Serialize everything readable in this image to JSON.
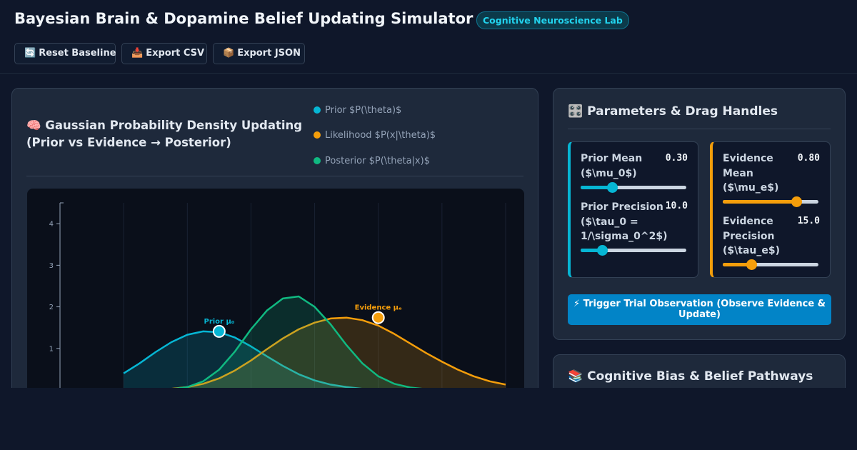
{
  "header": {
    "title": "Bayesian Brain & Dopamine Belief Updating Simulator",
    "badge": "Cognitive Neuroscience Lab"
  },
  "toolbar": {
    "reset": {
      "icon": "🔄",
      "icon_name": "refresh-icon",
      "label": "Reset Baseline"
    },
    "export_csv": {
      "icon": "📥",
      "icon_name": "inbox-tray-icon",
      "label": "Export CSV"
    },
    "export_json": {
      "icon": "📦",
      "icon_name": "package-icon",
      "label": "Export JSON"
    }
  },
  "chart_panel": {
    "icon": "🧠",
    "icon_name": "brain-icon",
    "title": "Gaussian Probability Density Updating (Prior vs Evidence → Posterior)",
    "legend": [
      {
        "label": "Prior $P(\\theta)$",
        "color": "#06b6d4"
      },
      {
        "label": "Likelihood $P(x|\\theta)$",
        "color": "#f59e0b"
      },
      {
        "label": "Posterior $P(\\theta|x)$",
        "color": "#10b981"
      }
    ]
  },
  "chart_data": {
    "type": "area",
    "x": [
      0.0,
      0.05,
      0.1,
      0.15,
      0.2,
      0.25,
      0.3,
      0.35,
      0.4,
      0.45,
      0.5,
      0.55,
      0.6,
      0.65,
      0.7,
      0.75,
      0.8,
      0.85,
      0.9,
      0.95,
      1.0,
      1.05,
      1.1,
      1.15,
      1.2
    ],
    "xlim": [
      -0.2,
      1.2
    ],
    "ylim": [
      0,
      4.5
    ],
    "yticks": [
      1,
      2,
      3,
      4
    ],
    "series": [
      {
        "name": "Prior $P(\\theta)$",
        "color": "#06b6d4",
        "values": [
          0.4,
          0.64,
          0.91,
          1.15,
          1.33,
          1.41,
          1.39,
          1.26,
          1.05,
          0.81,
          0.58,
          0.38,
          0.23,
          0.13,
          0.07,
          0.03,
          0.02,
          0.01,
          0.0,
          0.0,
          0.0,
          0.0,
          0.0,
          0.0,
          0.0
        ]
      },
      {
        "name": "Likelihood $P(x|\\theta)$",
        "color": "#f59e0b",
        "values": [
          0.0,
          0.0,
          0.01,
          0.03,
          0.07,
          0.15,
          0.28,
          0.47,
          0.71,
          0.98,
          1.24,
          1.46,
          1.62,
          1.72,
          1.74,
          1.68,
          1.55,
          1.35,
          1.12,
          0.89,
          0.68,
          0.49,
          0.33,
          0.21,
          0.13
        ]
      },
      {
        "name": "Posterior $P(\\theta|x)$",
        "color": "#10b981",
        "values": [
          0.0,
          0.0,
          0.0,
          0.02,
          0.07,
          0.21,
          0.49,
          0.93,
          1.46,
          1.91,
          2.2,
          2.25,
          2.0,
          1.58,
          1.08,
          0.64,
          0.33,
          0.15,
          0.06,
          0.02,
          0.0,
          0.0,
          0.0,
          0.0,
          0.0
        ]
      }
    ],
    "markers": [
      {
        "label": "Prior μ₀",
        "x": 0.3,
        "y": 1.41,
        "color": "#06b6d4"
      },
      {
        "label": "Evidence μₑ",
        "x": 0.8,
        "y": 1.74,
        "color": "#f59e0b"
      }
    ]
  },
  "params_panel": {
    "icon": "🎛️",
    "icon_name": "control-knobs-icon",
    "title": "Parameters & Drag Handles",
    "prior_mean": {
      "label": "Prior Mean ($\\mu_0$)",
      "value": "0.30",
      "fraction": 0.3
    },
    "prior_precision": {
      "label": "Prior Precision ($\\tau_0 = 1/\\sigma_0^2$)",
      "value": "10.0",
      "fraction": 0.2
    },
    "evidence_mean": {
      "label": "Evidence Mean ($\\mu_e$)",
      "value": "0.80",
      "fraction": 0.77
    },
    "evidence_precision": {
      "label": "Evidence Precision ($\\tau_e$)",
      "value": "15.0",
      "fraction": 0.3
    },
    "prior_color": "#06b6d4",
    "evidence_color": "#f59e0b",
    "trigger_icon": "⚡",
    "trigger_icon_name": "lightning-icon",
    "trigger_label": "Trigger Trial Observation (Observe Evidence & Update)"
  },
  "bias_panel": {
    "icon": "📚",
    "icon_name": "books-icon",
    "title": "Cognitive Bias & Belief Pathways"
  }
}
